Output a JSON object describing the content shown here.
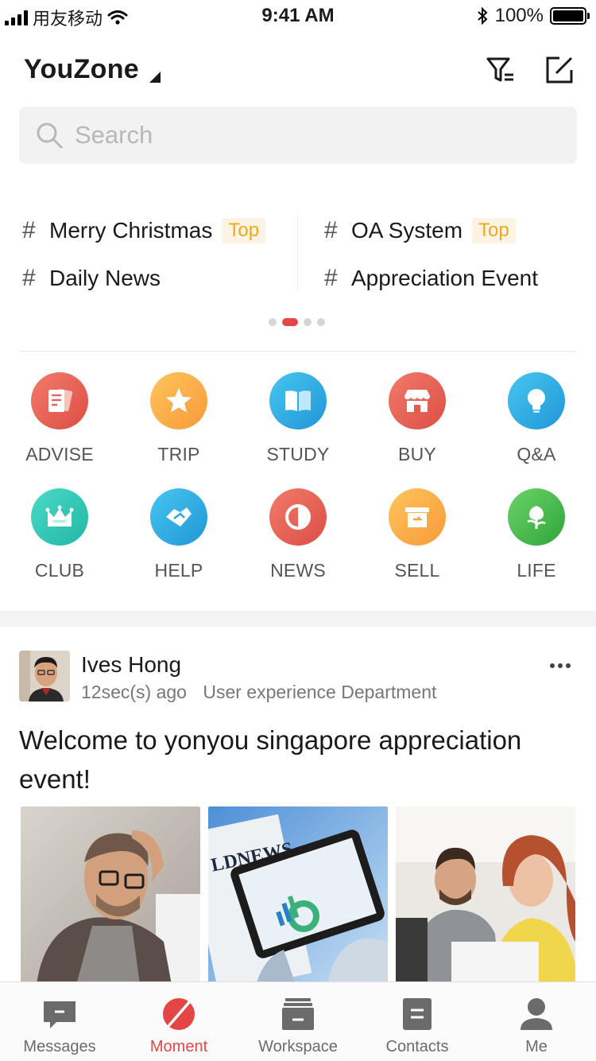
{
  "status_bar": {
    "carrier": "用友移动",
    "time": "9:41 AM",
    "battery": "100%"
  },
  "header": {
    "title": "YouZone"
  },
  "search": {
    "placeholder": "Search"
  },
  "topics": [
    {
      "label": "Merry Christmas",
      "tag": "Top"
    },
    {
      "label": "OA System",
      "tag": "Top"
    },
    {
      "label": "Daily News",
      "tag": ""
    },
    {
      "label": "Appreciation Event",
      "tag": ""
    }
  ],
  "topic_pager": {
    "current_page": 2,
    "page_count": 4
  },
  "categories": [
    {
      "label": "ADVISE",
      "icon": "document-icon"
    },
    {
      "label": "TRIP",
      "icon": "star-icon"
    },
    {
      "label": "STUDY",
      "icon": "book-icon"
    },
    {
      "label": "BUY",
      "icon": "shop-icon"
    },
    {
      "label": "Q&A",
      "icon": "lightbulb-icon"
    },
    {
      "label": "CLUB",
      "icon": "crown-icon"
    },
    {
      "label": "HELP",
      "icon": "handshake-icon"
    },
    {
      "label": "NEWS",
      "icon": "half-circle-icon"
    },
    {
      "label": "SELL",
      "icon": "box-icon"
    },
    {
      "label": "LIFE",
      "icon": "plant-icon"
    }
  ],
  "post": {
    "author": "Ives Hong",
    "time": "12sec(s) ago",
    "department": "User experience Department",
    "text": "Welcome to yonyou singapore appreciation event!",
    "photo_caption": "LDNEWS"
  },
  "tabs": [
    {
      "label": "Messages",
      "icon": "message-icon"
    },
    {
      "label": "Moment",
      "icon": "moment-icon"
    },
    {
      "label": "Workspace",
      "icon": "workspace-icon"
    },
    {
      "label": "Contacts",
      "icon": "contacts-icon"
    },
    {
      "label": "Me",
      "icon": "person-icon"
    }
  ],
  "colors": {
    "accent": "#e44545",
    "tag_text": "#f0a81e",
    "tag_bg": "#fbf3e3"
  }
}
